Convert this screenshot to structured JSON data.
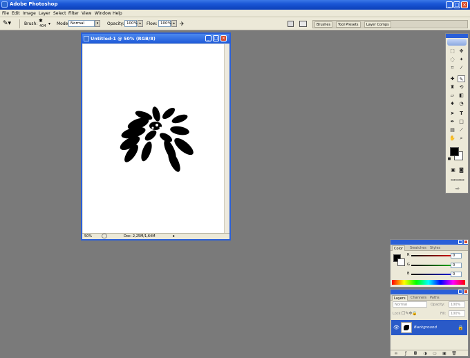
{
  "app": {
    "title": "Adobe Photoshop"
  },
  "menu": [
    "File",
    "Edit",
    "Image",
    "Layer",
    "Select",
    "Filter",
    "View",
    "Window",
    "Help"
  ],
  "options": {
    "brush_label": "Brush:",
    "brush_size": "404",
    "mode_label": "Mode:",
    "mode_value": "Normal",
    "opacity_label": "Opacity:",
    "opacity_value": "100%",
    "flow_label": "Flow:",
    "flow_value": "100%"
  },
  "palette_well": [
    "Brushes",
    "Tool Presets",
    "Layer Comps"
  ],
  "document": {
    "title": "Untitled-1 @ 50% (RGB/8)",
    "zoom": "50%",
    "doc_info": "Doc: 2,25M/1,64M"
  },
  "color_panel": {
    "tabs": [
      "Color",
      "Swatches",
      "Styles"
    ],
    "channels": [
      {
        "label": "R",
        "value": "0",
        "color": "#d02020"
      },
      {
        "label": "G",
        "value": "0",
        "color": "#20a020"
      },
      {
        "label": "B",
        "value": "0",
        "color": "#2020c0"
      }
    ]
  },
  "layers_panel": {
    "tabs": [
      "Layers",
      "Channels",
      "Paths"
    ],
    "blend_mode": "Normal",
    "opacity_label": "Opacity:",
    "opacity_value": "100%",
    "lock_label": "Lock:",
    "fill_label": "Fill:",
    "fill_value": "100%",
    "layer_name": "Background"
  },
  "colors": {
    "titlebar": "#1a56d6",
    "workspace": "#7a7a7a",
    "selection": "#2a5ac8"
  }
}
